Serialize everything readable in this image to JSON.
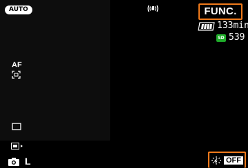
{
  "mode": {
    "label": "AUTO"
  },
  "stabilizer": {
    "icon": "hand-shake-icon"
  },
  "func_button": {
    "label": "FUNC."
  },
  "battery": {
    "icon": "battery-icon",
    "remaining_time": "133min"
  },
  "storage": {
    "card_label": "SD",
    "shots_remaining": "539"
  },
  "focus": {
    "label": "AF",
    "icon": "af-frame-icon"
  },
  "aspect": {
    "icon": "rectangle-icon"
  },
  "drive": {
    "icon": "drive-mode-icon"
  },
  "quality": {
    "icon": "camera-icon",
    "label": "L"
  },
  "flash": {
    "icon": "flash-icon",
    "state": "OFF"
  },
  "colors": {
    "highlight": "#f07a1b",
    "sd_badge": "#1fae2a"
  }
}
